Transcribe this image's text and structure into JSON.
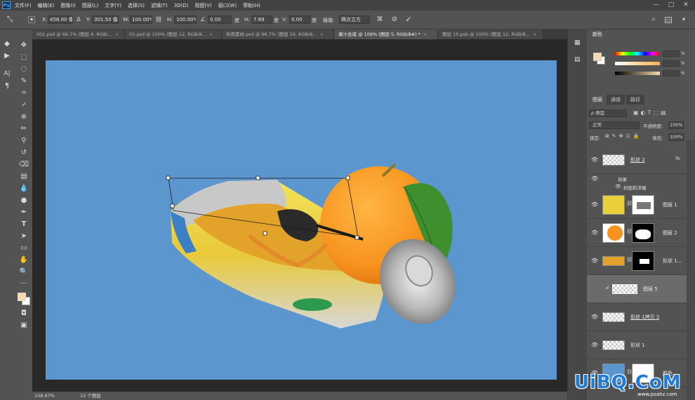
{
  "menubar": {
    "items": [
      "文件(F)",
      "编辑(E)",
      "图像(I)",
      "图层(L)",
      "文字(Y)",
      "选择(S)",
      "滤镜(T)",
      "3D(D)",
      "视图(V)",
      "窗口(W)",
      "帮助(H)"
    ],
    "logo": "Ps"
  },
  "options": {
    "x_label": "X:",
    "x_value": "458.00 像素",
    "y_label": "Y:",
    "y_value": "301.50 像素",
    "w_label": "W:",
    "w_value": "100.00%",
    "h_label": "H:",
    "h_value": "100.00%",
    "angle_value": "0.00",
    "angle_unit": "度",
    "hskew_label": "H:",
    "hskew_value": "7.89",
    "hskew_unit": "度",
    "vskew_label": "V:",
    "vskew_value": "0.00",
    "vskew_unit": "度",
    "interp_label": "插值:",
    "interp_value": "两次立方"
  },
  "tabs": [
    {
      "label": "001.psd @ 66.7% (图层 4, RGB/...",
      "active": false
    },
    {
      "label": "03.psd @ 100% (图层 12, RGB/8...",
      "active": false
    },
    {
      "label": "所用素材.psd @ 66.7% (图层 10, RGB/8...",
      "active": false
    },
    {
      "label": "果汁合成 @ 109% (图层 5, RGB/8#) *",
      "active": true
    },
    {
      "label": "图层 10.psb @ 100% (图层 12, RGB/8...",
      "active": false
    }
  ],
  "status": {
    "zoom": "108.67%",
    "doc_info": "12 个图层"
  },
  "color_panel": {
    "tab": "颜色",
    "fields": [
      "",
      "",
      ""
    ],
    "percent": [
      "%",
      "%",
      "%"
    ]
  },
  "layers_panel": {
    "tabs": [
      "图层",
      "通道",
      "路径"
    ],
    "filter_label": "ρ 类型",
    "blend_mode": "正常",
    "opacity_label": "不透明度:",
    "opacity_value": "100%",
    "lock_label": "锁定:",
    "fill_label": "填充:",
    "fill_value": "100%",
    "fx": "fx",
    "effects_label": "效果",
    "bevel_label": "斜面和浮雕",
    "layers": [
      {
        "name": "形状 2",
        "selected": false
      },
      {
        "name": "图层 1",
        "selected": false
      },
      {
        "name": "图层 2",
        "selected": false
      },
      {
        "name": "形状 1...",
        "selected": false
      },
      {
        "name": "图层 5",
        "selected": true
      },
      {
        "name": "形状 1拷贝 2",
        "selected": false
      },
      {
        "name": "形状 1",
        "selected": false
      },
      {
        "name": "颜色...",
        "selected": false
      }
    ]
  },
  "watermark": {
    "brand": "UiBQ.CoM",
    "sub": "www.psahz.com"
  },
  "colors": {
    "canvas_bg": "#5c96cf",
    "foreground": "#f6d9ad",
    "background": "#ffffff",
    "watermark": "#1f7bd6"
  }
}
